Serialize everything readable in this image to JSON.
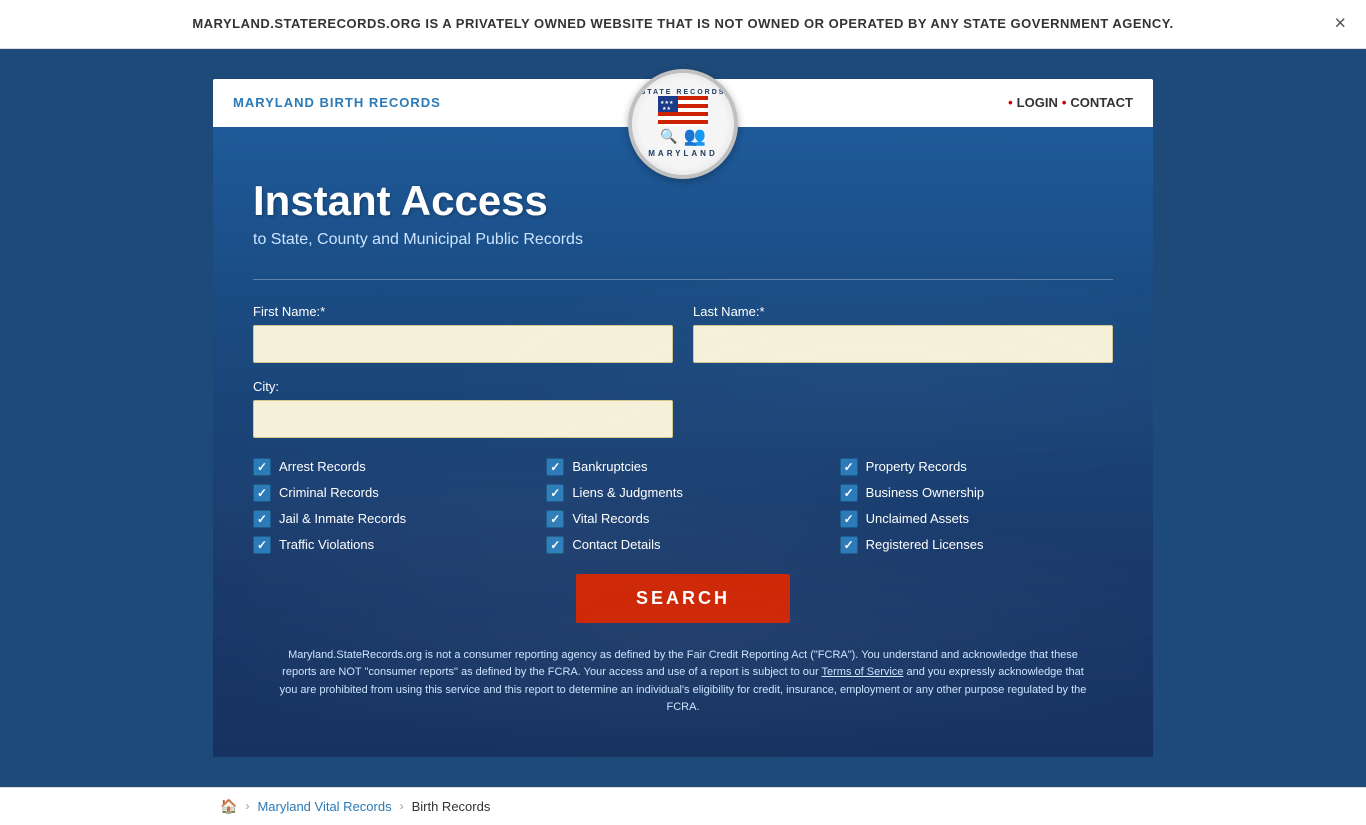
{
  "banner": {
    "text": "MARYLAND.STATERECORDS.ORG IS A PRIVATELY OWNED WEBSITE THAT IS NOT OWNED OR OPERATED BY ANY STATE GOVERNMENT AGENCY.",
    "close_label": "×"
  },
  "logo": {
    "top_text": "STATE RECORDS",
    "bottom_text": "MARYLAND",
    "stars": "★ ★ ★"
  },
  "nav": {
    "title": "MARYLAND BIRTH RECORDS",
    "login_label": "LOGIN",
    "contact_label": "CONTACT"
  },
  "form": {
    "title": "Instant Access",
    "subtitle": "to State, County and Municipal Public Records",
    "first_name_label": "First Name:*",
    "first_name_placeholder": "",
    "last_name_label": "Last Name:*",
    "last_name_placeholder": "",
    "city_label": "City:",
    "city_placeholder": "",
    "search_button": "SEARCH"
  },
  "checkboxes": [
    {
      "label": "Arrest Records",
      "checked": true
    },
    {
      "label": "Bankruptcies",
      "checked": true
    },
    {
      "label": "Property Records",
      "checked": true
    },
    {
      "label": "Criminal Records",
      "checked": true
    },
    {
      "label": "Liens & Judgments",
      "checked": true
    },
    {
      "label": "Business Ownership",
      "checked": true
    },
    {
      "label": "Jail & Inmate Records",
      "checked": true
    },
    {
      "label": "Vital Records",
      "checked": true
    },
    {
      "label": "Unclaimed Assets",
      "checked": true
    },
    {
      "label": "Traffic Violations",
      "checked": true
    },
    {
      "label": "Contact Details",
      "checked": true
    },
    {
      "label": "Registered Licenses",
      "checked": true
    }
  ],
  "disclaimer": {
    "text1": "Maryland.StateRecords.org is not a consumer reporting agency as defined by the Fair Credit Reporting Act (\"FCRA\"). You understand and acknowledge that these reports are NOT \"consumer reports\" as defined by the FCRA. Your access and use of a report is subject to our ",
    "tos_link": "Terms of Service",
    "text2": " and you expressly acknowledge that you are prohibited from using this service and this report to determine an individual's eligibility for credit, insurance, employment or any other purpose regulated by the FCRA."
  },
  "breadcrumb": {
    "home_icon": "🏠",
    "maryland_vital_records": "Maryland Vital Records",
    "current": "Birth Records"
  }
}
